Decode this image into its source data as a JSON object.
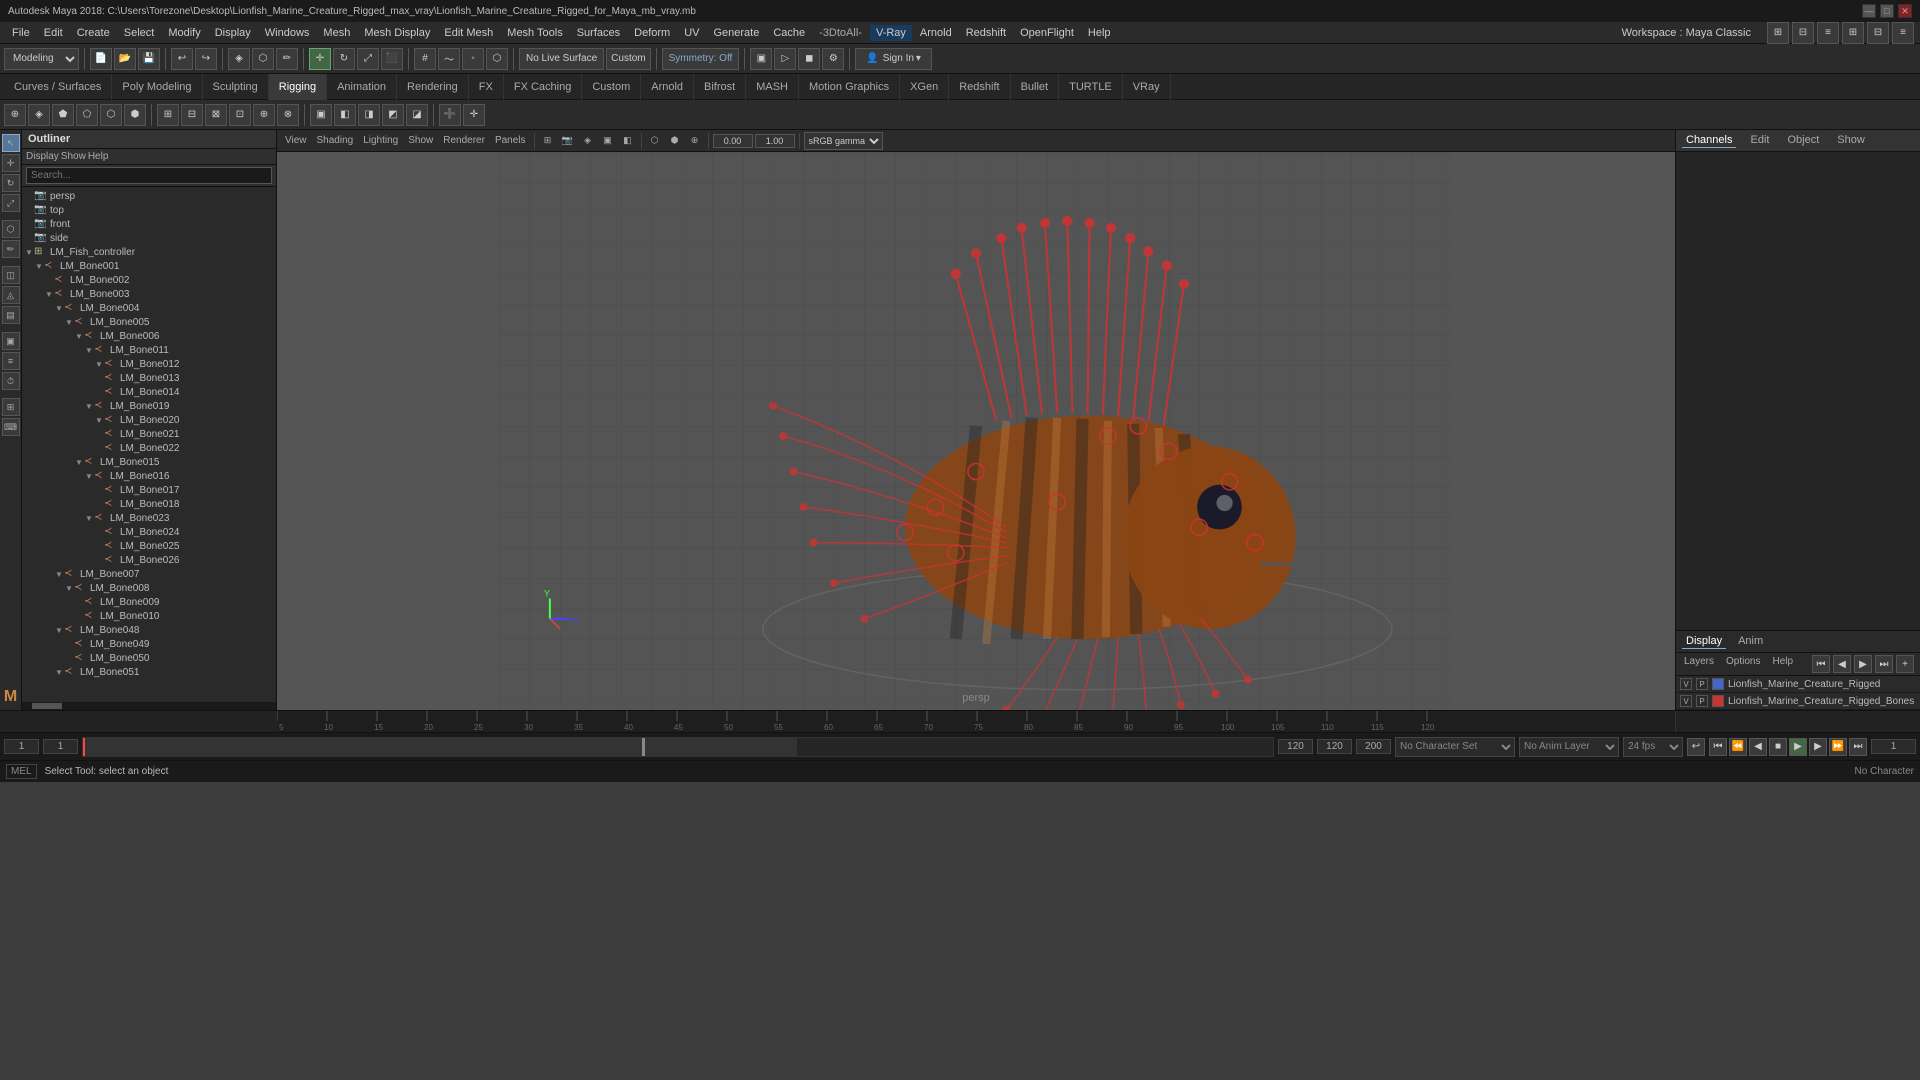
{
  "titlebar": {
    "title": "Autodesk Maya 2018: C:\\Users\\Torezone\\Desktop\\Lionfish_Marine_Creature_Rigged_max_vray\\Lionfish_Marine_Creature_Rigged_for_Maya_mb_vray.mb",
    "minimize": "—",
    "maximize": "□",
    "close": "✕"
  },
  "menubar": {
    "items": [
      "File",
      "Edit",
      "Create",
      "Select",
      "Modify",
      "Display",
      "Windows",
      "Mesh",
      "Mesh Display",
      "Edit Mesh",
      "Mesh Tools",
      "Surfaces",
      "Deform",
      "UV",
      "Generate",
      "Cache",
      "-3DtoAll-",
      "V-Ray",
      "Arnold",
      "Redshift",
      "OpenFlight",
      "Help"
    ],
    "workspace_label": "Workspace : Maya Classic",
    "vray_item": "V-Ray"
  },
  "toolbar1": {
    "mode_dropdown": "Modeling",
    "no_live_surface": "No Live Surface",
    "symmetry_off": "Symmetry: Off",
    "sign_in": "Sign In",
    "custom_btn": "Custom"
  },
  "tabs": {
    "items": [
      "Curves / Surfaces",
      "Poly Modeling",
      "Sculpting",
      "Rigging",
      "Animation",
      "Rendering",
      "FX",
      "FX Caching",
      "Custom",
      "Arnold",
      "Bifrost",
      "MASH",
      "Motion Graphics",
      "XGen",
      "Redshift",
      "Bullet",
      "TURTLE",
      "VRay"
    ]
  },
  "outliner": {
    "header": "Outliner",
    "toolbar_items": [
      "Display",
      "Show",
      "Help"
    ],
    "search_placeholder": "Search...",
    "camera_label": "persp",
    "tree_items": [
      {
        "indent": 0,
        "name": "persp",
        "type": "camera"
      },
      {
        "indent": 0,
        "name": "top",
        "type": "camera"
      },
      {
        "indent": 0,
        "name": "front",
        "type": "camera"
      },
      {
        "indent": 0,
        "name": "side",
        "type": "camera"
      },
      {
        "indent": 0,
        "name": "LM_Fish_controller",
        "type": "group",
        "expanded": true
      },
      {
        "indent": 1,
        "name": "LM_Bone001",
        "type": "bone",
        "expanded": true
      },
      {
        "indent": 2,
        "name": "LM_Bone002",
        "type": "bone"
      },
      {
        "indent": 2,
        "name": "LM_Bone003",
        "type": "bone",
        "expanded": true
      },
      {
        "indent": 3,
        "name": "LM_Bone004",
        "type": "bone",
        "expanded": true
      },
      {
        "indent": 4,
        "name": "LM_Bone005",
        "type": "bone",
        "expanded": true
      },
      {
        "indent": 5,
        "name": "LM_Bone006",
        "type": "bone",
        "expanded": true
      },
      {
        "indent": 6,
        "name": "LM_Bone011",
        "type": "bone",
        "expanded": true
      },
      {
        "indent": 7,
        "name": "LM_Bone012",
        "type": "bone",
        "expanded": true
      },
      {
        "indent": 7,
        "name": "LM_Bone013",
        "type": "bone"
      },
      {
        "indent": 7,
        "name": "LM_Bone014",
        "type": "bone"
      },
      {
        "indent": 6,
        "name": "LM_Bone019",
        "type": "bone",
        "expanded": true
      },
      {
        "indent": 7,
        "name": "LM_Bone020",
        "type": "bone",
        "expanded": true
      },
      {
        "indent": 7,
        "name": "LM_Bone021",
        "type": "bone"
      },
      {
        "indent": 7,
        "name": "LM_Bone022",
        "type": "bone"
      },
      {
        "indent": 5,
        "name": "LM_Bone015",
        "type": "bone",
        "expanded": true
      },
      {
        "indent": 6,
        "name": "LM_Bone016",
        "type": "bone",
        "expanded": true
      },
      {
        "indent": 7,
        "name": "LM_Bone017",
        "type": "bone"
      },
      {
        "indent": 7,
        "name": "LM_Bone018",
        "type": "bone"
      },
      {
        "indent": 6,
        "name": "LM_Bone023",
        "type": "bone",
        "expanded": true
      },
      {
        "indent": 7,
        "name": "LM_Bone024",
        "type": "bone"
      },
      {
        "indent": 7,
        "name": "LM_Bone025",
        "type": "bone"
      },
      {
        "indent": 7,
        "name": "LM_Bone026",
        "type": "bone"
      },
      {
        "indent": 3,
        "name": "LM_Bone007",
        "type": "bone",
        "expanded": true
      },
      {
        "indent": 4,
        "name": "LM_Bone008",
        "type": "bone",
        "expanded": true
      },
      {
        "indent": 5,
        "name": "LM_Bone009",
        "type": "bone"
      },
      {
        "indent": 5,
        "name": "LM_Bone010",
        "type": "bone"
      },
      {
        "indent": 3,
        "name": "LM_Bone048",
        "type": "bone",
        "expanded": true
      },
      {
        "indent": 4,
        "name": "LM_Bone049",
        "type": "bone"
      },
      {
        "indent": 4,
        "name": "LM_Bone050",
        "type": "bone"
      },
      {
        "indent": 3,
        "name": "LM_Bone051",
        "type": "bone"
      }
    ]
  },
  "viewport": {
    "label": "persp",
    "view_menu": "View",
    "shading_menu": "Shading",
    "lighting_menu": "Lighting",
    "show_menu": "Show",
    "renderer_menu": "Renderer",
    "panels_menu": "Panels",
    "gamma_value": "sRGB gamma",
    "coord_x": "0.00",
    "coord_y": "1.00"
  },
  "channels": {
    "header_tabs": [
      "Channels",
      "Edit",
      "Object",
      "Show"
    ],
    "display_tab": "Display",
    "anim_tab": "Anim",
    "sub_tabs": [
      "Layers",
      "Options",
      "Help"
    ],
    "layers": [
      {
        "v": "V",
        "p": "P",
        "name": "Lionfish_Marine_Creature_Rigged",
        "color": "blue"
      },
      {
        "v": "V",
        "p": "P",
        "name": "Lionfish_Marine_Creature_Rigged_Bones",
        "color": "red"
      }
    ]
  },
  "timeline": {
    "start_frame": "1",
    "current_frame": "1",
    "range_start": "1",
    "range_end": "120",
    "end_frame": "120",
    "total_end": "200",
    "fps": "24 fps",
    "no_character_set": "No Character Set",
    "no_anim_layer": "No Anim Layer",
    "ticks": [
      "5",
      "10",
      "15",
      "20",
      "25",
      "30",
      "35",
      "40",
      "45",
      "50",
      "55",
      "60",
      "65",
      "70",
      "75",
      "80",
      "85",
      "90",
      "95",
      "100",
      "105",
      "110",
      "115",
      "120"
    ]
  },
  "playback": {
    "prev_key": "⏮",
    "step_back": "◀◀",
    "play_back": "◀",
    "stop": "■",
    "play": "▶",
    "step_fwd": "▶▶",
    "next_key": "⏭"
  },
  "statusbar": {
    "mel_label": "MEL",
    "status_msg": "Select Tool: select an object",
    "no_character": "No Character"
  }
}
